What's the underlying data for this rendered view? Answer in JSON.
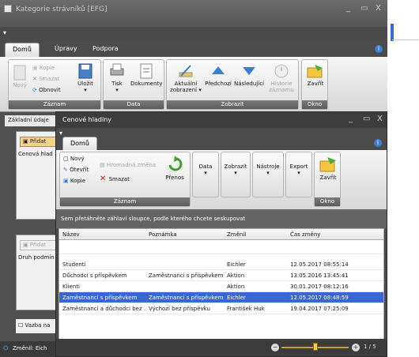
{
  "back": {
    "title": "Kategorie strávníků [EFG]",
    "tabs": [
      "Domů",
      "Úpravy",
      "Podpora"
    ],
    "groups": {
      "zaznam": {
        "label": "Záznam",
        "new": "Nový",
        "copy": "Kopie",
        "delete": "Smazat",
        "refresh": "Obnovit",
        "save": "Uložit"
      },
      "data": {
        "label": "Data",
        "print": "Tisk",
        "docs": "Dokumenty"
      },
      "zobrazit": {
        "label": "Zobrazit",
        "current": "Aktuální zobrazení",
        "prev": "Předchozí",
        "next": "Následující",
        "history": "Historie záznamu"
      },
      "okno": {
        "label": "Okno",
        "close": "Zavřít"
      }
    },
    "tab_basic": "Základní údaje",
    "add_label": "Přidat",
    "field_cenova": "Cenová hlad",
    "field_druh": "Druh podmín",
    "vazba": "Vazba na",
    "status": "Změnil: Eich"
  },
  "front": {
    "title": "Cenové hladiny",
    "tab": "Domů",
    "groups": {
      "zaznam": {
        "label": "Záznam",
        "new": "Nový",
        "open": "Otevřít",
        "copy": "Kopie",
        "bulk": "Hromadná změna",
        "delete": "Smazat",
        "transfer": "Přenos"
      },
      "data": "Data",
      "zobrazit": "Zobrazit",
      "nastroje": "Nástroje",
      "export": "Export",
      "okno": {
        "label": "Okno",
        "close": "Zavřít"
      }
    },
    "group_hint": "Sem přetáhněte záhlaví sloupce, podle kterého chcete seskupovat",
    "columns": [
      "Název",
      "Poznámka",
      "Změnil",
      "Čas změny"
    ],
    "rows": [
      {
        "nazev": "Studenti",
        "poznamka": "",
        "zmenil": "Eichler",
        "cas": "12.05.2017 08:55:14"
      },
      {
        "nazev": "Důchodci s příspěvkem",
        "poznamka": "Zaměstnanci s příspěvkem",
        "zmenil": "Aktion",
        "cas": "13.05.2016 13:45:41"
      },
      {
        "nazev": "Klienti",
        "poznamka": "",
        "zmenil": "Aktion",
        "cas": "30.01.2017 08:12:16"
      },
      {
        "nazev": "Zaměstnanci s příspěvkem",
        "poznamka": "Zaměstnanci s příspěvkem",
        "zmenil": "Eichler",
        "cas": "12.05.2017 08:48:59"
      },
      {
        "nazev": "Zaměstnanci a důchodci bez ...",
        "poznamka": "Výchozí bez příspěvku",
        "zmenil": "František Huk",
        "cas": "19.04.2017 07:25:09"
      }
    ],
    "page": "1 / 5"
  }
}
